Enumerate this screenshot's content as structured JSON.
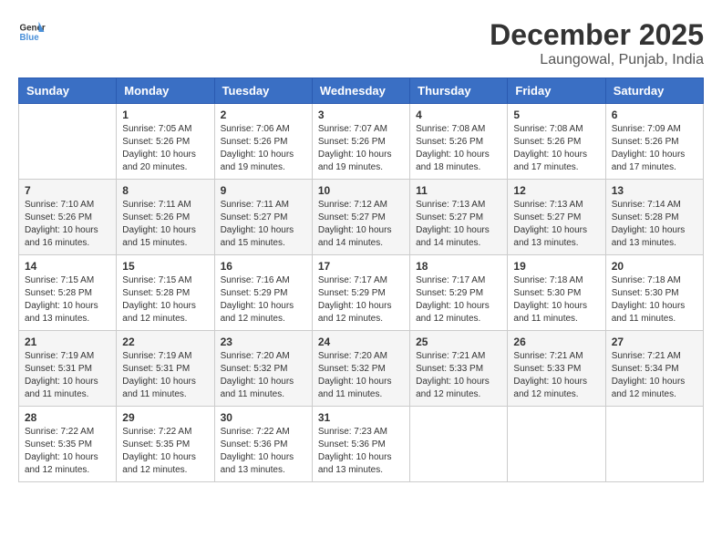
{
  "header": {
    "logo_line1": "General",
    "logo_line2": "Blue",
    "month": "December 2025",
    "location": "Laungowal, Punjab, India"
  },
  "days_of_week": [
    "Sunday",
    "Monday",
    "Tuesday",
    "Wednesday",
    "Thursday",
    "Friday",
    "Saturday"
  ],
  "weeks": [
    [
      {
        "num": "",
        "info": ""
      },
      {
        "num": "1",
        "info": "Sunrise: 7:05 AM\nSunset: 5:26 PM\nDaylight: 10 hours\nand 20 minutes."
      },
      {
        "num": "2",
        "info": "Sunrise: 7:06 AM\nSunset: 5:26 PM\nDaylight: 10 hours\nand 19 minutes."
      },
      {
        "num": "3",
        "info": "Sunrise: 7:07 AM\nSunset: 5:26 PM\nDaylight: 10 hours\nand 19 minutes."
      },
      {
        "num": "4",
        "info": "Sunrise: 7:08 AM\nSunset: 5:26 PM\nDaylight: 10 hours\nand 18 minutes."
      },
      {
        "num": "5",
        "info": "Sunrise: 7:08 AM\nSunset: 5:26 PM\nDaylight: 10 hours\nand 17 minutes."
      },
      {
        "num": "6",
        "info": "Sunrise: 7:09 AM\nSunset: 5:26 PM\nDaylight: 10 hours\nand 17 minutes."
      }
    ],
    [
      {
        "num": "7",
        "info": "Sunrise: 7:10 AM\nSunset: 5:26 PM\nDaylight: 10 hours\nand 16 minutes."
      },
      {
        "num": "8",
        "info": "Sunrise: 7:11 AM\nSunset: 5:26 PM\nDaylight: 10 hours\nand 15 minutes."
      },
      {
        "num": "9",
        "info": "Sunrise: 7:11 AM\nSunset: 5:27 PM\nDaylight: 10 hours\nand 15 minutes."
      },
      {
        "num": "10",
        "info": "Sunrise: 7:12 AM\nSunset: 5:27 PM\nDaylight: 10 hours\nand 14 minutes."
      },
      {
        "num": "11",
        "info": "Sunrise: 7:13 AM\nSunset: 5:27 PM\nDaylight: 10 hours\nand 14 minutes."
      },
      {
        "num": "12",
        "info": "Sunrise: 7:13 AM\nSunset: 5:27 PM\nDaylight: 10 hours\nand 13 minutes."
      },
      {
        "num": "13",
        "info": "Sunrise: 7:14 AM\nSunset: 5:28 PM\nDaylight: 10 hours\nand 13 minutes."
      }
    ],
    [
      {
        "num": "14",
        "info": "Sunrise: 7:15 AM\nSunset: 5:28 PM\nDaylight: 10 hours\nand 13 minutes."
      },
      {
        "num": "15",
        "info": "Sunrise: 7:15 AM\nSunset: 5:28 PM\nDaylight: 10 hours\nand 12 minutes."
      },
      {
        "num": "16",
        "info": "Sunrise: 7:16 AM\nSunset: 5:29 PM\nDaylight: 10 hours\nand 12 minutes."
      },
      {
        "num": "17",
        "info": "Sunrise: 7:17 AM\nSunset: 5:29 PM\nDaylight: 10 hours\nand 12 minutes."
      },
      {
        "num": "18",
        "info": "Sunrise: 7:17 AM\nSunset: 5:29 PM\nDaylight: 10 hours\nand 12 minutes."
      },
      {
        "num": "19",
        "info": "Sunrise: 7:18 AM\nSunset: 5:30 PM\nDaylight: 10 hours\nand 11 minutes."
      },
      {
        "num": "20",
        "info": "Sunrise: 7:18 AM\nSunset: 5:30 PM\nDaylight: 10 hours\nand 11 minutes."
      }
    ],
    [
      {
        "num": "21",
        "info": "Sunrise: 7:19 AM\nSunset: 5:31 PM\nDaylight: 10 hours\nand 11 minutes."
      },
      {
        "num": "22",
        "info": "Sunrise: 7:19 AM\nSunset: 5:31 PM\nDaylight: 10 hours\nand 11 minutes."
      },
      {
        "num": "23",
        "info": "Sunrise: 7:20 AM\nSunset: 5:32 PM\nDaylight: 10 hours\nand 11 minutes."
      },
      {
        "num": "24",
        "info": "Sunrise: 7:20 AM\nSunset: 5:32 PM\nDaylight: 10 hours\nand 11 minutes."
      },
      {
        "num": "25",
        "info": "Sunrise: 7:21 AM\nSunset: 5:33 PM\nDaylight: 10 hours\nand 12 minutes."
      },
      {
        "num": "26",
        "info": "Sunrise: 7:21 AM\nSunset: 5:33 PM\nDaylight: 10 hours\nand 12 minutes."
      },
      {
        "num": "27",
        "info": "Sunrise: 7:21 AM\nSunset: 5:34 PM\nDaylight: 10 hours\nand 12 minutes."
      }
    ],
    [
      {
        "num": "28",
        "info": "Sunrise: 7:22 AM\nSunset: 5:35 PM\nDaylight: 10 hours\nand 12 minutes."
      },
      {
        "num": "29",
        "info": "Sunrise: 7:22 AM\nSunset: 5:35 PM\nDaylight: 10 hours\nand 12 minutes."
      },
      {
        "num": "30",
        "info": "Sunrise: 7:22 AM\nSunset: 5:36 PM\nDaylight: 10 hours\nand 13 minutes."
      },
      {
        "num": "31",
        "info": "Sunrise: 7:23 AM\nSunset: 5:36 PM\nDaylight: 10 hours\nand 13 minutes."
      },
      {
        "num": "",
        "info": ""
      },
      {
        "num": "",
        "info": ""
      },
      {
        "num": "",
        "info": ""
      }
    ]
  ]
}
